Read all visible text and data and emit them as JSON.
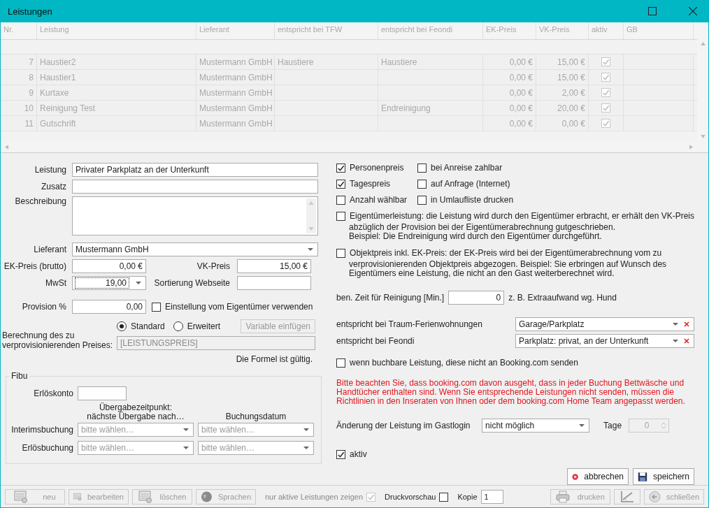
{
  "window": {
    "title": "Leistungen"
  },
  "table": {
    "disabled": true,
    "columns": [
      "Nr.",
      "Leistung",
      "Lieferant",
      "entspricht bei TFW",
      "entspricht bei Feondi",
      "EK-Preis",
      "VK-Preis",
      "aktiv",
      "GB"
    ],
    "rows": [
      {
        "nr": "7",
        "leistung": "Haustier2",
        "lieferant": "Mustermann GmbH",
        "tfw": "Haustiere",
        "feondi": "Haustiere",
        "ek": "0,00 €",
        "vk": "15,00 €",
        "aktiv": true
      },
      {
        "nr": "8",
        "leistung": "Haustier1",
        "lieferant": "Mustermann GmbH",
        "ek": "0,00 €",
        "vk": "15,00 €",
        "aktiv": true
      },
      {
        "nr": "9",
        "leistung": "Kurtaxe",
        "lieferant": "Mustermann GmbH",
        "ek": "0,00 €",
        "vk": "2,00 €",
        "aktiv": true
      },
      {
        "nr": "10",
        "leistung": "Reinigung Test",
        "lieferant": "Mustermann GmbH",
        "feondi": "Endreinigung",
        "ek": "0,00 €",
        "vk": "20,00 €",
        "aktiv": true
      },
      {
        "nr": "11",
        "leistung": "Gutschrift",
        "lieferant": "Mustermann GmbH",
        "ek": "0,00 €",
        "vk": "0,00 €",
        "aktiv": true
      }
    ]
  },
  "form": {
    "leistung": {
      "label": "Leistung",
      "value": "Privater Parkplatz an der Unterkunft"
    },
    "zusatz": {
      "label": "Zusatz"
    },
    "beschreibung": {
      "label": "Beschreibung"
    },
    "lieferant": {
      "label": "Lieferant",
      "value": "Mustermann GmbH"
    },
    "ek_preis": {
      "label": "EK-Preis (brutto)",
      "value": "0,00 €"
    },
    "vk_preis": {
      "label": "VK-Preis",
      "value": "15,00 €"
    },
    "mwst": {
      "label": "MwSt",
      "value": "19,00"
    },
    "sortierung": {
      "label": "Sortierung Webseite"
    },
    "provision": {
      "label": "Provision %",
      "value": "0,00"
    },
    "eigentuemer_einstellung": {
      "label": "Einstellung vom Eigentümer verwenden",
      "checked": false
    },
    "berechnung": {
      "label": "Berechnung des zu verprovisionierenden Preises:",
      "modes": [
        {
          "label": "Standard",
          "selected": true
        },
        {
          "label": "Erweitert",
          "selected": false
        }
      ],
      "variable_button": {
        "label": "Variable einfügen",
        "disabled": true
      },
      "formula": "[LEISTUNGSPREIS]",
      "status": "Die Formel ist gültig."
    },
    "fibu": {
      "title": "Fibu",
      "erloeskonto": {
        "label": "Erlöskonto"
      },
      "col_headers": [
        "Übergabezeitpunkt:\nnächste Übergabe nach…",
        "Buchungsdatum"
      ],
      "rows": [
        {
          "label": "Interimsbuchung",
          "placeholders": [
            "bitte wählen…",
            "bitte wählen…"
          ]
        },
        {
          "label": "Erlösbuchung",
          "placeholders": [
            "bitte wählen…",
            "bitte wählen…"
          ]
        }
      ]
    }
  },
  "options": {
    "flags": [
      {
        "label": "Personenpreis",
        "checked": true
      },
      {
        "label": "bei Anreise zahlbar",
        "checked": false
      },
      {
        "label": "Tagespreis",
        "checked": true
      },
      {
        "label": "auf Anfrage (Internet)",
        "checked": false
      },
      {
        "label": "Anzahl wählbar",
        "checked": false
      },
      {
        "label": "in Umlaufliste drucken",
        "checked": false
      }
    ],
    "long_flags": [
      {
        "label": "Eigentümerleistung: die Leistung wird durch den Eigentümer erbracht, er erhält den VK-Preis",
        "detail": "abzüglich der Provision bei der Eigentümerabrechnung gutgeschrieben.\nBeispiel: Die Endreinigung wird durch den Eigentümer durchgeführt.",
        "checked": false
      },
      {
        "label": "Objektpreis inkl. EK-Preis: der EK-Preis wird bei der Eigentümerabrechnung vom zu",
        "detail": "verprovisionierenden Objektpreis abgezogen. Beispiel: Sie erbringen auf Wunsch des\nEigentümers eine Leistung, die nicht an den Gast weiterberechnet wird.",
        "checked": false
      }
    ],
    "reinigung": {
      "label": "ben. Zeit für Reinigung [Min.]",
      "value": "0",
      "hint": "z. B. Extraaufwand wg. Hund"
    },
    "mappings": [
      {
        "label": "entspricht bei Traum-Ferienwohnungen",
        "value": "Garage/Parkplatz"
      },
      {
        "label": "entspricht bei Feondi",
        "value": "Parkplatz: privat, an der Unterkunft"
      }
    ],
    "booking": {
      "label": "wenn buchbare Leistung, diese nicht an Booking.com senden",
      "checked": false
    },
    "warning": "Bitte beachten Sie, dass booking.com davon ausgeht, dass in jeder Buchung Bettwäsche und Handtücher enthalten sind. Wenn Sie entsprechende Leistungen nicht senden, müssen die Richtlinien in den Inseraten von Ihnen oder dem booking.com Home Team angepasst werden.",
    "gastlogin": {
      "label": "Änderung der Leistung im Gastlogin",
      "value": "nicht möglich",
      "tage_label": "Tage",
      "tage_value": "0",
      "tage_disabled": true
    },
    "aktiv": {
      "label": "aktiv",
      "checked": true
    },
    "cancel": "abbrechen",
    "save": "speichern"
  },
  "toolbar": {
    "buttons": [
      {
        "kind": "new",
        "label": "neu",
        "disabled": true
      },
      {
        "kind": "edit",
        "label": "bearbeiten",
        "disabled": true
      },
      {
        "kind": "delete",
        "label": "löschen",
        "disabled": true
      },
      {
        "kind": "globe",
        "label": "Sprachen",
        "disabled": true
      }
    ],
    "only_active": {
      "label": "nur aktive Leistungen zeigen",
      "checked": true,
      "disabled": true
    },
    "preview": {
      "label": "Druckvorschau",
      "checked": false
    },
    "copies": {
      "label": "Kopie",
      "value": "1"
    },
    "right_buttons": [
      {
        "kind": "print",
        "label": "drucken",
        "disabled": true
      },
      {
        "kind": "chart",
        "disabled": true
      },
      {
        "kind": "back",
        "label": "schließen",
        "disabled": true
      }
    ]
  }
}
